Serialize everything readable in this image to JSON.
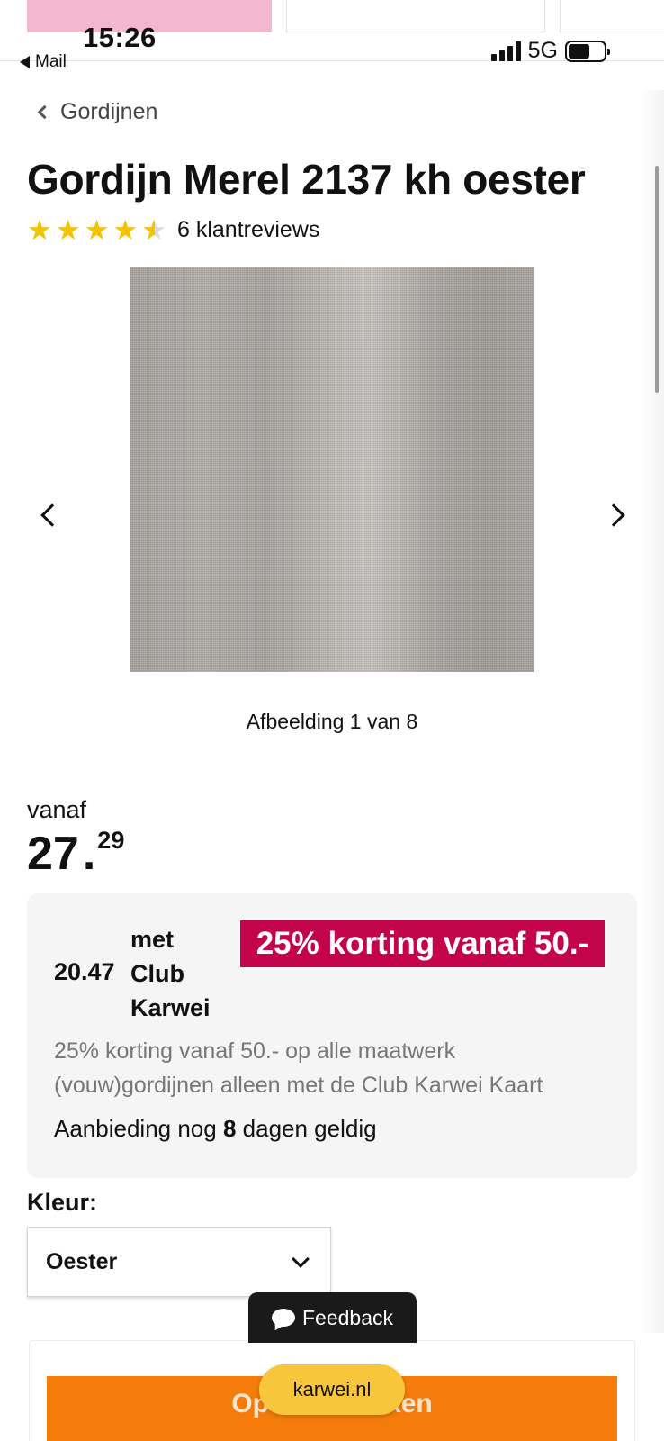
{
  "status_bar": {
    "time": "15:26",
    "back_app": "Mail",
    "network": "5G"
  },
  "breadcrumb": {
    "label": "Gordijnen"
  },
  "product": {
    "title": "Gordijn Merel 2137 kh oester",
    "rating": {
      "stars": 4.5,
      "max": 5,
      "reviews_label": "6 klantreviews"
    }
  },
  "gallery": {
    "counter": "Afbeelding 1 van 8",
    "prev_icon": "chevron-left-icon",
    "next_icon": "chevron-right-icon"
  },
  "price": {
    "from_label": "vanaf",
    "integer": "27",
    "separator": ".",
    "decimals": "29"
  },
  "promo": {
    "club_price": "20.47",
    "club_label": "met Club Karwei",
    "badge": "25% korting vanaf 50.-",
    "badge_color": "#c4034d",
    "description": "25% korting vanaf 50.- op alle maatwerk (vouw)gordijnen alleen met de Club Karwei Kaart",
    "validity_before": "Aanbieding nog",
    "validity_days": "8",
    "validity_after": "dagen geldig"
  },
  "color_selector": {
    "label": "Kleur:",
    "selected": "Oester"
  },
  "feedback": {
    "label": "Feedback"
  },
  "cta": {
    "label": "Op maat maken",
    "color": "#f57c0b"
  },
  "browser": {
    "url": "karwei.nl",
    "pill_color": "#f7c63a"
  }
}
